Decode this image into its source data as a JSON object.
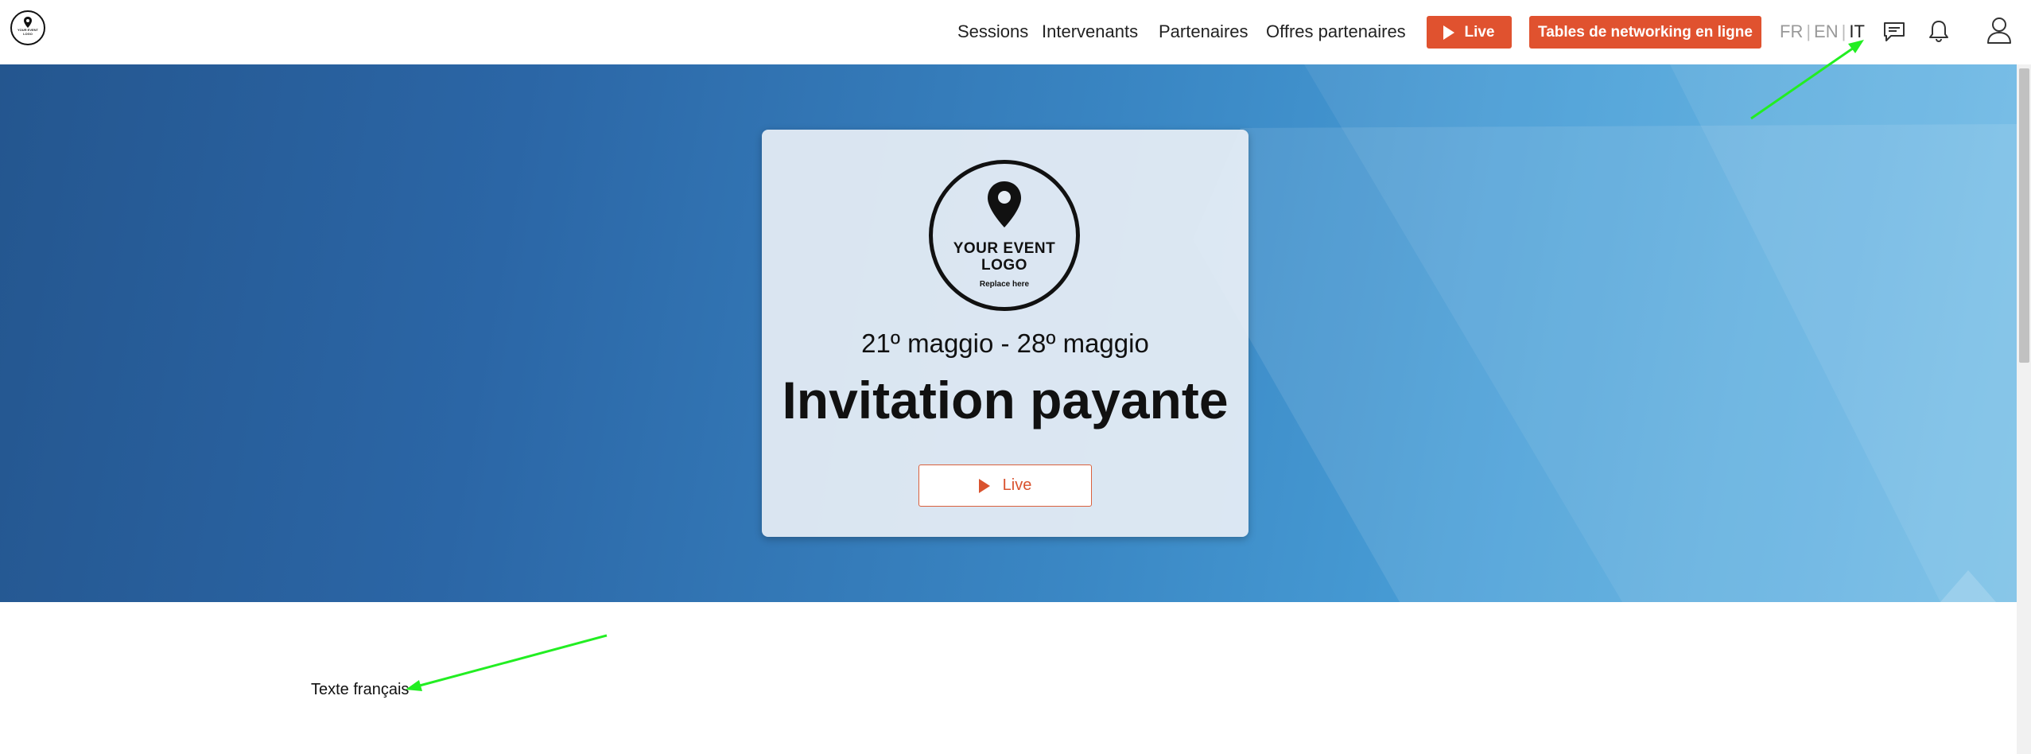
{
  "header": {
    "logo_alt": "Your event logo",
    "nav": {
      "sessions": "Sessions",
      "speakers": "Intervenants",
      "partners": "Partenaires",
      "partner_offers": "Offres partenaires"
    },
    "live_button": "Live",
    "networking_button": "Tables de networking en ligne",
    "languages": {
      "fr": "FR",
      "en": "EN",
      "it": "IT",
      "active": "IT"
    },
    "icons": [
      "chat-icon",
      "bell-icon",
      "user-icon"
    ]
  },
  "hero": {
    "event_logo": {
      "line1": "YOUR EVENT",
      "line2": "LOGO",
      "subline": "Replace here"
    },
    "dates": "21º maggio - 28º maggio",
    "title": "Invitation payante",
    "live_button": "Live"
  },
  "content": {
    "text": "Texte français"
  },
  "colors": {
    "accent_orange": "#e0522f",
    "hero_dark": "#24568f",
    "hero_light": "#66b7e4",
    "annotation_arrow": "#22ee22"
  }
}
